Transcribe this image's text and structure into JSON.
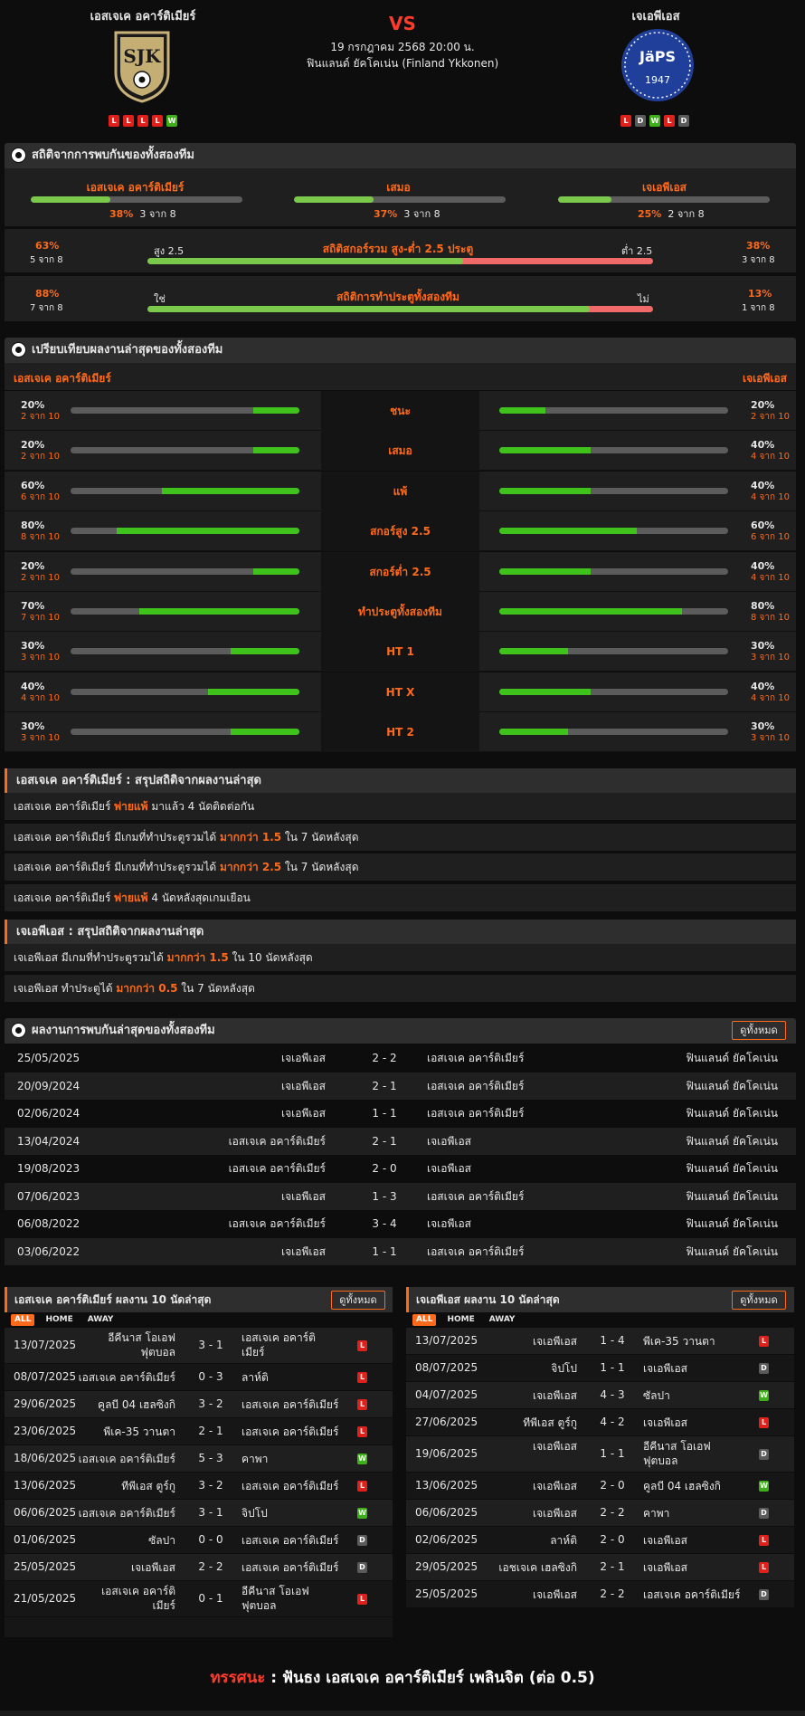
{
  "header": {
    "home_team": "เอสเจเค อคาร์ติเมียร์",
    "away_team": "เจเอพีเอส",
    "vs": "VS",
    "date": "19 กรกฎาคม 2568 20:00 น.",
    "league": "ฟินแลนด์ ยัคโคเน่น (Finland Ykkonen)",
    "home_logo_text": "SJK",
    "away_logo_text": "JäPS",
    "away_logo_year": "1947",
    "home_form": [
      "L",
      "L",
      "L",
      "L",
      "W"
    ],
    "away_form": [
      "L",
      "D",
      "W",
      "L",
      "D"
    ]
  },
  "h2h_stats": {
    "title": "สถิติจากการพบกันของทั้งสองทีม",
    "home": {
      "label": "เอสเจเค อคาร์ติเมียร์",
      "pct": "38%",
      "count": "3 จาก 8",
      "value": 0.375
    },
    "draw": {
      "label": "เสมอ",
      "pct": "37%",
      "count": "3 จาก 8",
      "value": 0.375
    },
    "away": {
      "label": "เจเอพีเอส",
      "pct": "25%",
      "count": "2 จาก 8",
      "value": 0.25
    },
    "ou": {
      "left_pct": "63%",
      "left_count": "5 จาก 8",
      "over_label": "สูง 2.5",
      "title": "สถิติสกอร์รวม สูง-ต่ำ 2.5 ประตู",
      "under_label": "ต่ำ 2.5",
      "right_pct": "38%",
      "right_count": "3 จาก 8",
      "value": 0.625
    },
    "btts": {
      "left_pct": "88%",
      "left_count": "7 จาก 8",
      "yes_label": "ใช่",
      "title": "สถิติการทำประตูทั้งสองทีม",
      "no_label": "ไม่",
      "right_pct": "13%",
      "right_count": "1 จาก 8",
      "value": 0.875
    }
  },
  "compare": {
    "title": "เปรียบเทียบผลงานล่าสุดของทั้งสองทีม",
    "home_label": "เอสเจเค อคาร์ติเมียร์",
    "away_label": "เจเอพีเอส",
    "rows": [
      {
        "label": "ชนะ",
        "hp": "20%",
        "hc": "2 จาก 10",
        "hv": 0.2,
        "ap": "20%",
        "ac": "2 จาก 10",
        "av": 0.2
      },
      {
        "label": "เสมอ",
        "hp": "20%",
        "hc": "2 จาก 10",
        "hv": 0.2,
        "ap": "40%",
        "ac": "4 จาก 10",
        "av": 0.4
      },
      {
        "label": "แพ้",
        "hp": "60%",
        "hc": "6 จาก 10",
        "hv": 0.6,
        "ap": "40%",
        "ac": "4 จาก 10",
        "av": 0.4
      },
      {
        "label": "สกอร์สูง 2.5",
        "hp": "80%",
        "hc": "8 จาก 10",
        "hv": 0.8,
        "ap": "60%",
        "ac": "6 จาก 10",
        "av": 0.6
      },
      {
        "label": "สกอร์ต่ำ 2.5",
        "hp": "20%",
        "hc": "2 จาก 10",
        "hv": 0.2,
        "ap": "40%",
        "ac": "4 จาก 10",
        "av": 0.4
      },
      {
        "label": "ทำประตูทั้งสองทีม",
        "hp": "70%",
        "hc": "7 จาก 10",
        "hv": 0.7,
        "ap": "80%",
        "ac": "8 จาก 10",
        "av": 0.8
      },
      {
        "label": "HT 1",
        "hp": "30%",
        "hc": "3 จาก 10",
        "hv": 0.3,
        "ap": "30%",
        "ac": "3 จาก 10",
        "av": 0.3
      },
      {
        "label": "HT X",
        "hp": "40%",
        "hc": "4 จาก 10",
        "hv": 0.4,
        "ap": "40%",
        "ac": "4 จาก 10",
        "av": 0.4
      },
      {
        "label": "HT 2",
        "hp": "30%",
        "hc": "3 จาก 10",
        "hv": 0.3,
        "ap": "30%",
        "ac": "3 จาก 10",
        "av": 0.3
      }
    ]
  },
  "home_summary": {
    "title": "เอสเจเค อคาร์ติเมียร์ : สรุปสถิติจากผลงานล่าสุด",
    "lines": [
      {
        "pre": "เอสเจเค อคาร์ติเมียร์ ",
        "hl": "พ่ายแพ้",
        "post": " มาแล้ว 4 นัดติดต่อกัน"
      },
      {
        "pre": "เอสเจเค อคาร์ติเมียร์ มีเกมที่ทำประตูรวมได้ ",
        "hl": "มากกว่า 1.5",
        "post": " ใน 7 นัดหลังสุด"
      },
      {
        "pre": "เอสเจเค อคาร์ติเมียร์ มีเกมที่ทำประตูรวมได้ ",
        "hl": "มากกว่า 2.5",
        "post": " ใน 7 นัดหลังสุด"
      },
      {
        "pre": "เอสเจเค อคาร์ติเมียร์ ",
        "hl": "พ่ายแพ้",
        "post": " 4 นัดหลังสุดเกมเยือน"
      }
    ]
  },
  "away_summary": {
    "title": "เจเอพีเอส : สรุปสถิติจากผลงานล่าสุด",
    "lines": [
      {
        "pre": "เจเอพีเอส มีเกมที่ทำประตูรวมได้ ",
        "hl": "มากกว่า 1.5",
        "post": " ใน 10 นัดหลังสุด"
      },
      {
        "pre": "เจเอพีเอส ทำประตูได้ ",
        "hl": "มากกว่า 0.5",
        "post": " ใน 7 นัดหลังสุด"
      }
    ]
  },
  "h2h_results": {
    "title": "ผลงานการพบกันล่าสุดของทั้งสองทีม",
    "view_all": "ดูทั้งหมด",
    "rows": [
      {
        "date": "25/05/2025",
        "home": "เจเอพีเอส",
        "score": "2 - 2",
        "away": "เอสเจเค อคาร์ติเมียร์",
        "league": "ฟินแลนด์ ยัคโคเน่น"
      },
      {
        "date": "20/09/2024",
        "home": "เจเอพีเอส",
        "score": "2 - 1",
        "away": "เอสเจเค อคาร์ติเมียร์",
        "league": "ฟินแลนด์ ยัคโคเน่น"
      },
      {
        "date": "02/06/2024",
        "home": "เจเอพีเอส",
        "score": "1 - 1",
        "away": "เอสเจเค อคาร์ติเมียร์",
        "league": "ฟินแลนด์ ยัคโคเน่น"
      },
      {
        "date": "13/04/2024",
        "home": "เอสเจเค อคาร์ติเมียร์",
        "score": "2 - 1",
        "away": "เจเอพีเอส",
        "league": "ฟินแลนด์ ยัคโคเน่น"
      },
      {
        "date": "19/08/2023",
        "home": "เอสเจเค อคาร์ติเมียร์",
        "score": "2 - 0",
        "away": "เจเอพีเอส",
        "league": "ฟินแลนด์ ยัคโคเน่น"
      },
      {
        "date": "07/06/2023",
        "home": "เจเอพีเอส",
        "score": "1 - 3",
        "away": "เอสเจเค อคาร์ติเมียร์",
        "league": "ฟินแลนด์ ยัคโคเน่น"
      },
      {
        "date": "06/08/2022",
        "home": "เอสเจเค อคาร์ติเมียร์",
        "score": "3 - 4",
        "away": "เจเอพีเอส",
        "league": "ฟินแลนด์ ยัคโคเน่น"
      },
      {
        "date": "03/06/2022",
        "home": "เจเอพีเอส",
        "score": "1 - 1",
        "away": "เอสเจเค อคาร์ติเมียร์",
        "league": "ฟินแลนด์ ยัคโคเน่น"
      }
    ]
  },
  "home_last10": {
    "title": "เอสเจเค อคาร์ติเมียร์ ผลงาน 10 นัดล่าสุด",
    "view_all": "ดูทั้งหมด",
    "tabs": [
      "ALL",
      "HOME",
      "AWAY"
    ],
    "rows": [
      {
        "date": "13/07/2025",
        "home": "อีคีนาส โอเอฟ ฟุตบอล",
        "score": "3 - 1",
        "away": "เอสเจเค อคาร์ติเมียร์",
        "res": "L",
        "tall": true
      },
      {
        "date": "08/07/2025",
        "home": "เอสเจเค อคาร์ติเมียร์",
        "score": "0 - 3",
        "away": "ลาห์ติ",
        "res": "L"
      },
      {
        "date": "29/06/2025",
        "home": "คูลบี 04 เฮลซิงกิ",
        "score": "3 - 2",
        "away": "เอสเจเค อคาร์ติเมียร์",
        "res": "L"
      },
      {
        "date": "23/06/2025",
        "home": "พีเค-35 วานตา",
        "score": "2 - 1",
        "away": "เอสเจเค อคาร์ติเมียร์",
        "res": "L"
      },
      {
        "date": "18/06/2025",
        "home": "เอสเจเค อคาร์ติเมียร์",
        "score": "5 - 3",
        "away": "คาพา",
        "res": "W"
      },
      {
        "date": "13/06/2025",
        "home": "ทีพีเอส ตูร์กู",
        "score": "3 - 2",
        "away": "เอสเจเค อคาร์ติเมียร์",
        "res": "L"
      },
      {
        "date": "06/06/2025",
        "home": "เอสเจเค อคาร์ติเมียร์",
        "score": "3 - 1",
        "away": "จิปโป",
        "res": "W"
      },
      {
        "date": "01/06/2025",
        "home": "ซัลปา",
        "score": "0 - 0",
        "away": "เอสเจเค อคาร์ติเมียร์",
        "res": "D"
      },
      {
        "date": "25/05/2025",
        "home": "เจเอพีเอส",
        "score": "2 - 2",
        "away": "เอสเจเค อคาร์ติเมียร์",
        "res": "D"
      },
      {
        "date": "21/05/2025",
        "home": "เอสเจเค อคาร์ติเมียร์",
        "score": "0 - 1",
        "away": "อีคีนาส โอเอฟ ฟุตบอล",
        "res": "L",
        "tall": true
      }
    ]
  },
  "away_last10": {
    "title": "เจเอพีเอส ผลงาน 10 นัดล่าสุด",
    "view_all": "ดูทั้งหมด",
    "tabs": [
      "ALL",
      "HOME",
      "AWAY"
    ],
    "rows": [
      {
        "date": "13/07/2025",
        "home": "เจเอพีเอส",
        "score": "1 - 4",
        "away": "พีเค-35 วานตา",
        "res": "L"
      },
      {
        "date": "08/07/2025",
        "home": "จิปโป",
        "score": "1 - 1",
        "away": "เจเอพีเอส",
        "res": "D"
      },
      {
        "date": "04/07/2025",
        "home": "เจเอพีเอส",
        "score": "4 - 3",
        "away": "ซัลปา",
        "res": "W"
      },
      {
        "date": "27/06/2025",
        "home": "ทีพีเอส ตูร์กู",
        "score": "4 - 2",
        "away": "เจเอพีเอส",
        "res": "L"
      },
      {
        "date": "19/06/2025",
        "home": "เจเอพีเอส",
        "score": "1 - 1",
        "away": "อีคีนาส โอเอฟ ฟุตบอล",
        "res": "D",
        "tall": true
      },
      {
        "date": "13/06/2025",
        "home": "เจเอพีเอส",
        "score": "2 - 0",
        "away": "คูลบี 04 เฮลซิงกิ",
        "res": "W"
      },
      {
        "date": "06/06/2025",
        "home": "เจเอพีเอส",
        "score": "2 - 2",
        "away": "คาพา",
        "res": "D"
      },
      {
        "date": "02/06/2025",
        "home": "ลาห์ติ",
        "score": "2 - 0",
        "away": "เจเอพีเอส",
        "res": "L"
      },
      {
        "date": "29/05/2025",
        "home": "เอชเจเค เฮลซิงกิ",
        "score": "2 - 1",
        "away": "เจเอพีเอส",
        "res": "L"
      },
      {
        "date": "25/05/2025",
        "home": "เจเอพีเอส",
        "score": "2 - 2",
        "away": "เอสเจเค อคาร์ติเมียร์",
        "res": "D"
      }
    ]
  },
  "verdict": {
    "label": "ทรรศนะ",
    "sep": " : ",
    "text": "ฟันธง เอสเจเค อคาร์ติเมียร์ เพลินจิต (ต่อ 0.5)"
  },
  "colors": {
    "accent": "#ff6a1a",
    "win": "#3fae1b",
    "loss": "#e0201b",
    "draw": "#5a5a5a",
    "bar_green": "#7bc94a",
    "bar_red": "#f06a6a"
  }
}
